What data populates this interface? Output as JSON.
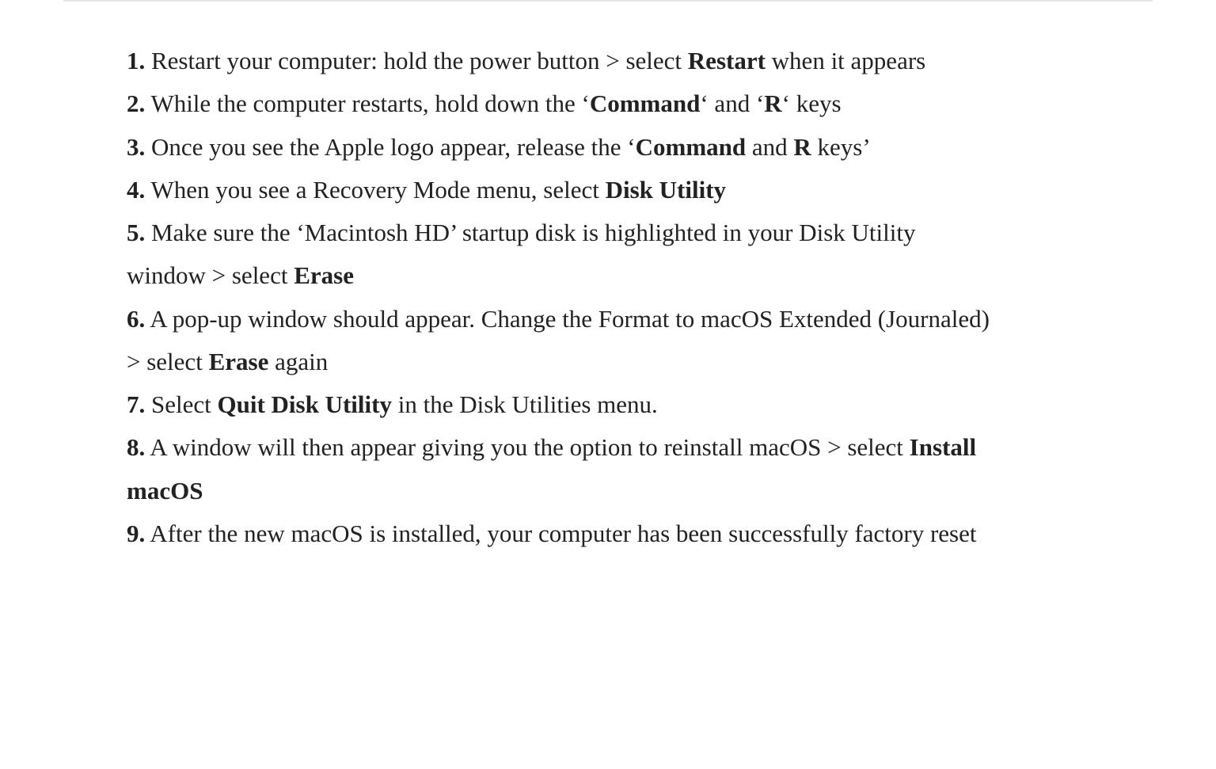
{
  "steps": [
    {
      "num": "1.",
      "parts": [
        {
          "t": " Restart your computer: hold the power button > select "
        },
        {
          "t": "Restart",
          "b": true
        },
        {
          "t": " when it appears"
        }
      ]
    },
    {
      "num": "2.",
      "parts": [
        {
          "t": " While the computer restarts, hold down the ‘"
        },
        {
          "t": "Command",
          "b": true
        },
        {
          "t": "‘ and ‘"
        },
        {
          "t": "R",
          "b": true
        },
        {
          "t": "‘ keys"
        }
      ]
    },
    {
      "num": "3.",
      "parts": [
        {
          "t": " Once you see the Apple logo appear, release the ‘"
        },
        {
          "t": "Command",
          "b": true
        },
        {
          "t": " and "
        },
        {
          "t": "R",
          "b": true
        },
        {
          "t": " keys’"
        }
      ]
    },
    {
      "num": "4.",
      "parts": [
        {
          "t": " When you see a Recovery Mode menu, select "
        },
        {
          "t": "Disk Utility",
          "b": true
        }
      ]
    },
    {
      "num": "5.",
      "parts": [
        {
          "t": " Make sure the ‘Macintosh HD’ startup disk is highlighted in your Disk Utility window > select "
        },
        {
          "t": "Erase",
          "b": true
        }
      ]
    },
    {
      "num": "6.",
      "parts": [
        {
          "t": " A pop-up window should appear. Change the Format to macOS Extended (Journaled) > select "
        },
        {
          "t": "Erase",
          "b": true
        },
        {
          "t": " again"
        }
      ]
    },
    {
      "num": "7.",
      "parts": [
        {
          "t": " Select "
        },
        {
          "t": "Quit Disk Utility",
          "b": true
        },
        {
          "t": " in the Disk Utilities menu."
        }
      ]
    },
    {
      "num": "8.",
      "parts": [
        {
          "t": " A window will then appear giving you the option to reinstall macOS > select "
        },
        {
          "t": "Install macOS",
          "b": true
        }
      ]
    },
    {
      "num": "9.",
      "parts": [
        {
          "t": " After the new macOS is installed, your computer has been successfully factory reset"
        }
      ]
    }
  ]
}
